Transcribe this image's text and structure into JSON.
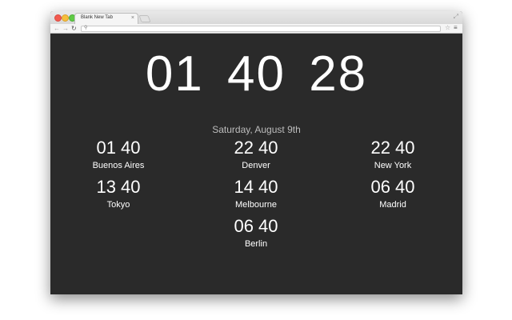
{
  "browser": {
    "tab_title": "Blank New Tab",
    "tab_close": "×",
    "address": ""
  },
  "icons": {
    "back": "back-arrow-icon",
    "forward": "forward-arrow-icon",
    "reload": "reload-icon",
    "search": "search-icon",
    "star": "star-icon",
    "menu": "menu-icon",
    "fullscreen": "fullscreen-icon",
    "settings": "gear-icon"
  },
  "clock": {
    "time": "01 40 28",
    "date": "Saturday, August 9th"
  },
  "cities": [
    {
      "name": "Buenos Aires",
      "time": "01 40"
    },
    {
      "name": "Denver",
      "time": "22 40"
    },
    {
      "name": "New York",
      "time": "22 40"
    },
    {
      "name": "Tokyo",
      "time": "13 40"
    },
    {
      "name": "Melbourne",
      "time": "14 40"
    },
    {
      "name": "Madrid",
      "time": "06 40"
    },
    {
      "name": "Berlin",
      "time": "06 40"
    }
  ],
  "colors": {
    "background": "#2a2a2a",
    "accent": "#3b8fd9"
  }
}
